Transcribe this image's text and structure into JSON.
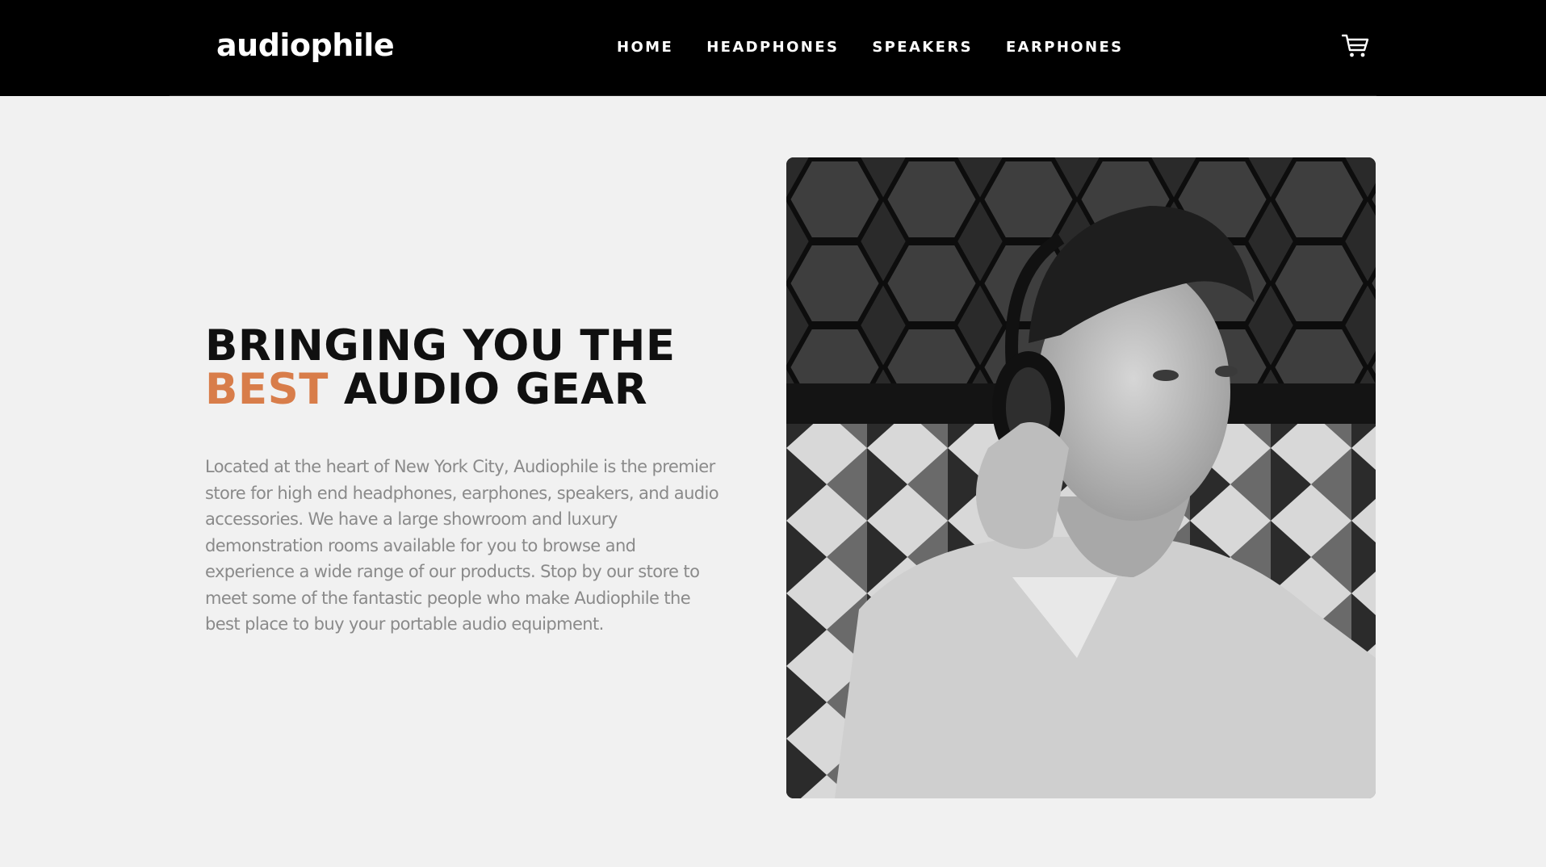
{
  "header": {
    "logo": "audiophile",
    "nav": [
      "HOME",
      "HEADPHONES",
      "SPEAKERS",
      "EARPHONES"
    ],
    "cart_icon": "cart-icon"
  },
  "hero": {
    "heading_line1": "BRINGING YOU THE",
    "heading_accent": "BEST",
    "heading_rest": "AUDIO GEAR",
    "paragraph": "Located at the heart of New York City, Audiophile is the premier store for high end headphones, earphones, speakers, and audio accessories. We have a large showroom and luxury demonstration rooms available for you to browse and experience a wide range of our products. Stop by our store to meet some of the fantastic people who make Audiophile the best place to buy your portable audio equipment."
  },
  "colors": {
    "accent": "#d87d4a",
    "header_bg": "#000000",
    "page_bg": "#f1f1f1"
  }
}
